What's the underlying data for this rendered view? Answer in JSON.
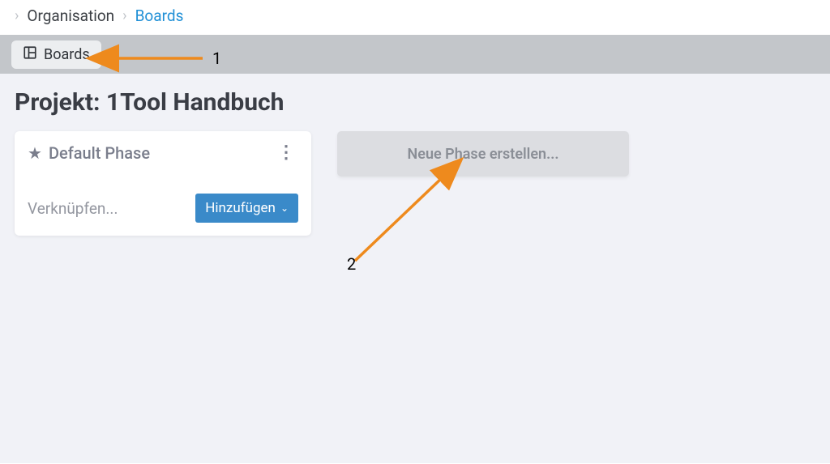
{
  "breadcrumb": {
    "level1": "Organisation",
    "level2": "Boards"
  },
  "tabs": {
    "boards_label": "Boards"
  },
  "project": {
    "title": "Projekt: 1Tool Handbuch"
  },
  "phase_card": {
    "name": "Default Phase",
    "link_label": "Verknüpfen...",
    "add_label": "Hinzufügen"
  },
  "new_phase": {
    "label": "Neue Phase erstellen..."
  },
  "annotations": {
    "num1": "1",
    "num2": "2"
  },
  "colors": {
    "accent_blue": "#3a8ac9",
    "link_blue": "#1f8fd6",
    "anno_orange": "#ee8a1d"
  }
}
